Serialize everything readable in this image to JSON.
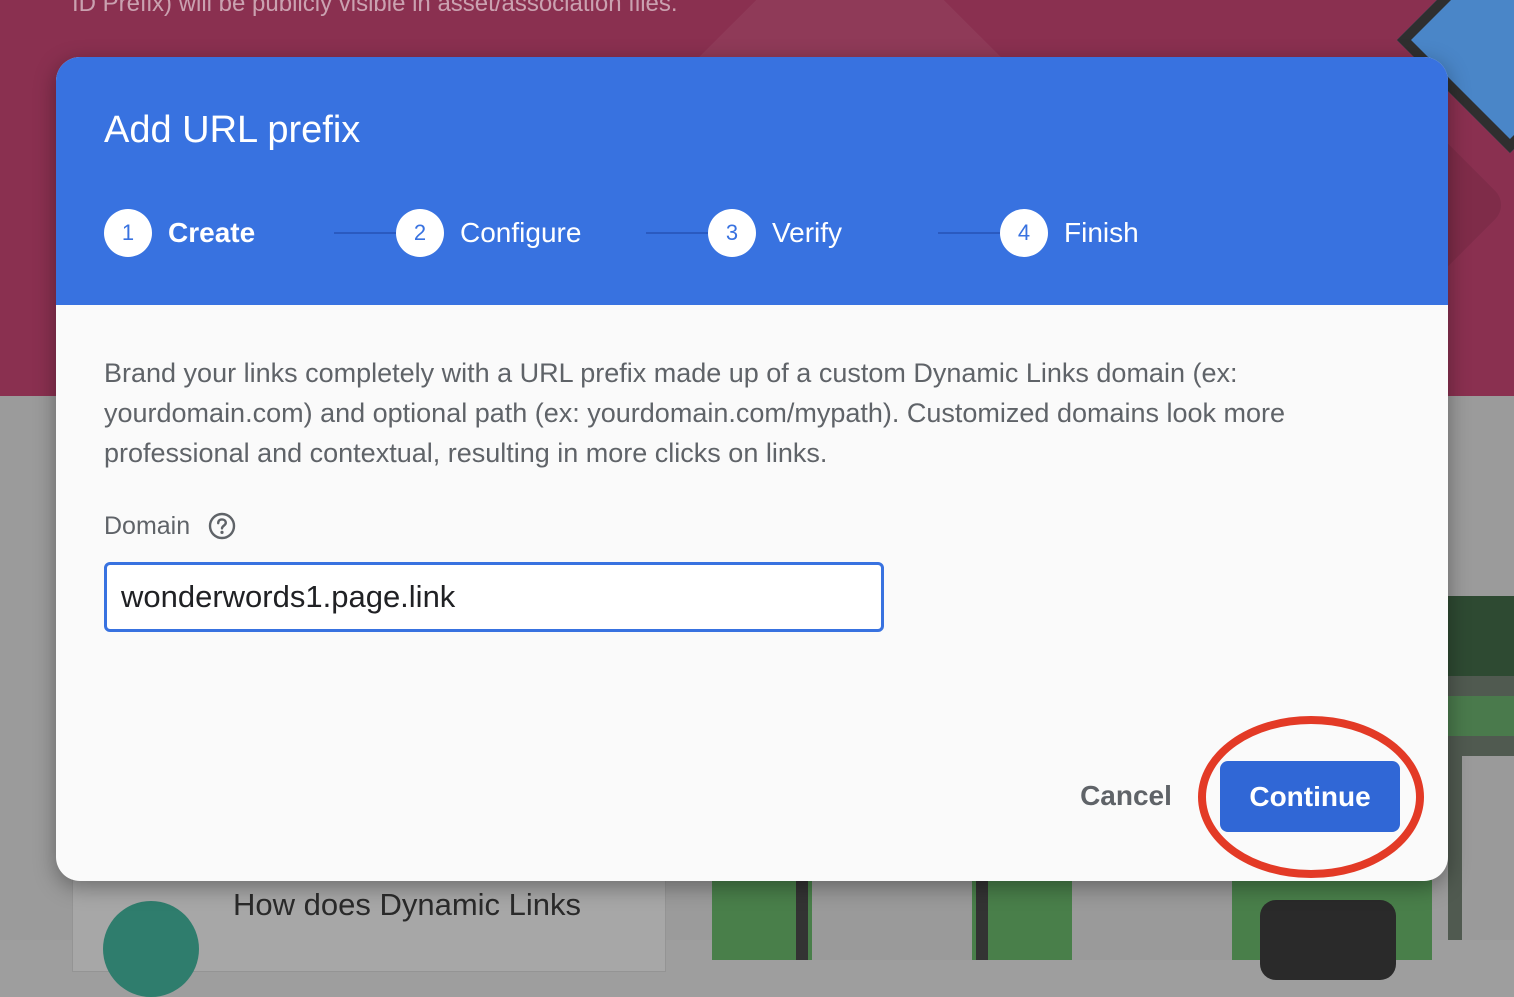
{
  "background": {
    "hero_text": "ID Prefix) will be publicly visible in asset/association files.",
    "card_title": "How does Dynamic Links"
  },
  "dialog": {
    "title": "Add URL prefix",
    "steps": [
      {
        "number": "1",
        "label": "Create",
        "active": true
      },
      {
        "number": "2",
        "label": "Configure",
        "active": false
      },
      {
        "number": "3",
        "label": "Verify",
        "active": false
      },
      {
        "number": "4",
        "label": "Finish",
        "active": false
      }
    ],
    "description": "Brand your links completely with a URL prefix made up of a custom Dynamic Links domain (ex: yourdomain.com) and optional path (ex: yourdomain.com/mypath). Customized domains look more professional and contextual, resulting in more clicks on links.",
    "domain_field": {
      "label": "Domain",
      "value": "wonderwords1.page.link",
      "help_icon": "help-circle-icon"
    },
    "actions": {
      "cancel_label": "Cancel",
      "continue_label": "Continue"
    }
  },
  "colors": {
    "header_blue": "#3872e0",
    "primary_button": "#3067d6",
    "annotation_red": "#e33a26",
    "hero_magenta": "#8a3050"
  }
}
